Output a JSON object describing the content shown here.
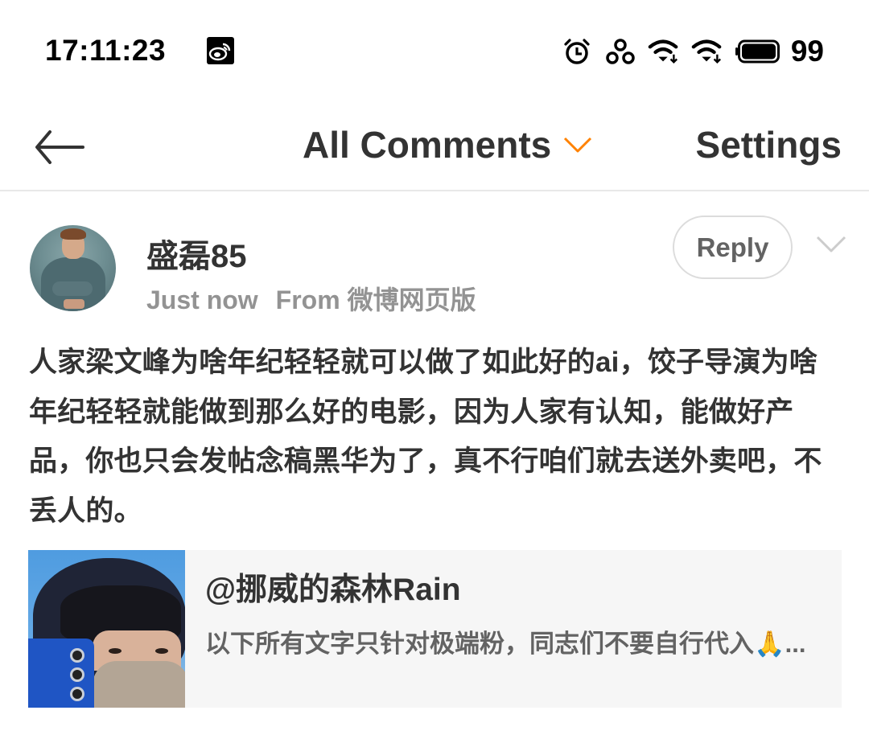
{
  "status_bar": {
    "time": "17:11:23",
    "notification_icons": [
      "weibo-icon"
    ],
    "system_icons": [
      "alarm-icon",
      "link-icon",
      "wifi-download-icon",
      "wifi-download-icon",
      "battery-icon"
    ],
    "battery_level": "99"
  },
  "nav": {
    "back_icon": "arrow-left-icon",
    "title": "All Comments",
    "title_chevron_color": "#ff8200",
    "settings_label": "Settings"
  },
  "comment": {
    "username": "盛磊85",
    "time": "Just now",
    "source": "From 微博网页版",
    "reply_label": "Reply",
    "more_icon": "chevron-down-icon",
    "text": "人家梁文峰为啥年纪轻轻就可以做了如此好的ai，饺子导演为啥年纪轻轻就能做到那么好的电影，因为人家有认知，能做好产品，你也只会发帖念稿黑华为了，真不行咱们就去送外卖吧，不丢人的。"
  },
  "quoted_post": {
    "author": "@挪威的森林Rain",
    "excerpt": "以下所有文字只针对极端粉，同志们不要自行代入🙏..."
  },
  "colors": {
    "accent": "#ff8200",
    "text_primary": "#333333",
    "text_secondary": "#939393",
    "card_background": "#f6f6f6",
    "divider": "#e8e8e8"
  }
}
